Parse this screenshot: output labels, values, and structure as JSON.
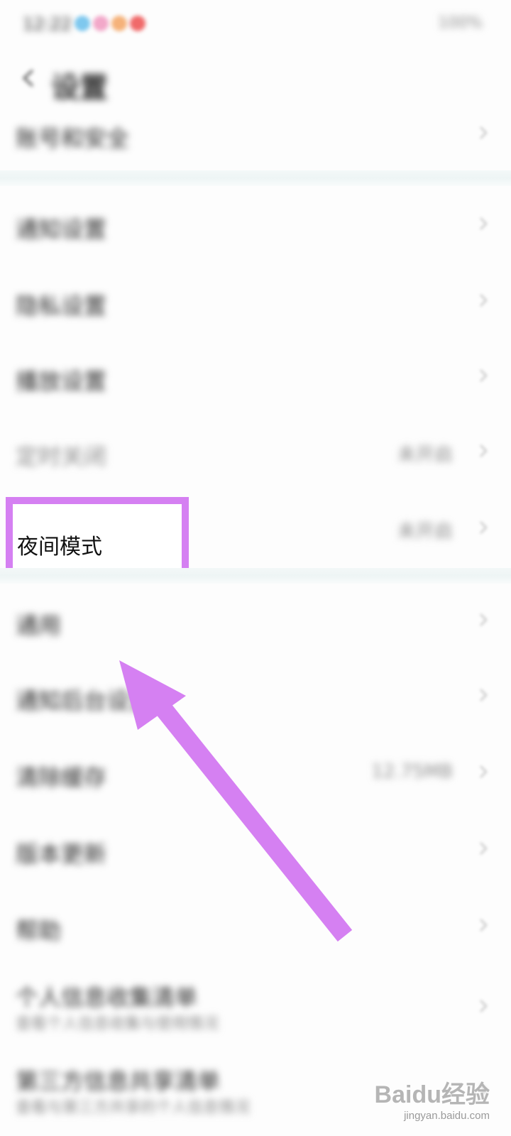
{
  "status_bar": {
    "time": "12:22",
    "right": "100%",
    "dot_colors": [
      "#7fc8ee",
      "#f2a8c9",
      "#f5b27a",
      "#f06a6a"
    ]
  },
  "header": {
    "title": "设置",
    "back_icon": "back-arrow-icon"
  },
  "rows": [
    {
      "label": "账号和安全"
    },
    {
      "label": "通知设置"
    },
    {
      "label": "隐私设置"
    },
    {
      "label": "播放设置"
    },
    {
      "label": "定时关闭",
      "value": "未开启"
    },
    {
      "label": "夜间模式",
      "value": "未开启"
    },
    {
      "label": "通用"
    },
    {
      "label": "通知后台设置"
    },
    {
      "label": "清除缓存",
      "value": "12.75MB"
    },
    {
      "label": "版本更新"
    },
    {
      "label": "帮助"
    },
    {
      "label": "个人信息收集清单",
      "sub": "查看个人信息收集与使用情况"
    },
    {
      "label": "第三方信息共享清单",
      "sub": "查看与第三方共享的个人信息情况"
    }
  ],
  "highlight_label": "夜间模式",
  "annotation_color": "#d580f2",
  "watermark": {
    "main": "Baidu经验",
    "sub": "jingyan.baidu.com"
  }
}
